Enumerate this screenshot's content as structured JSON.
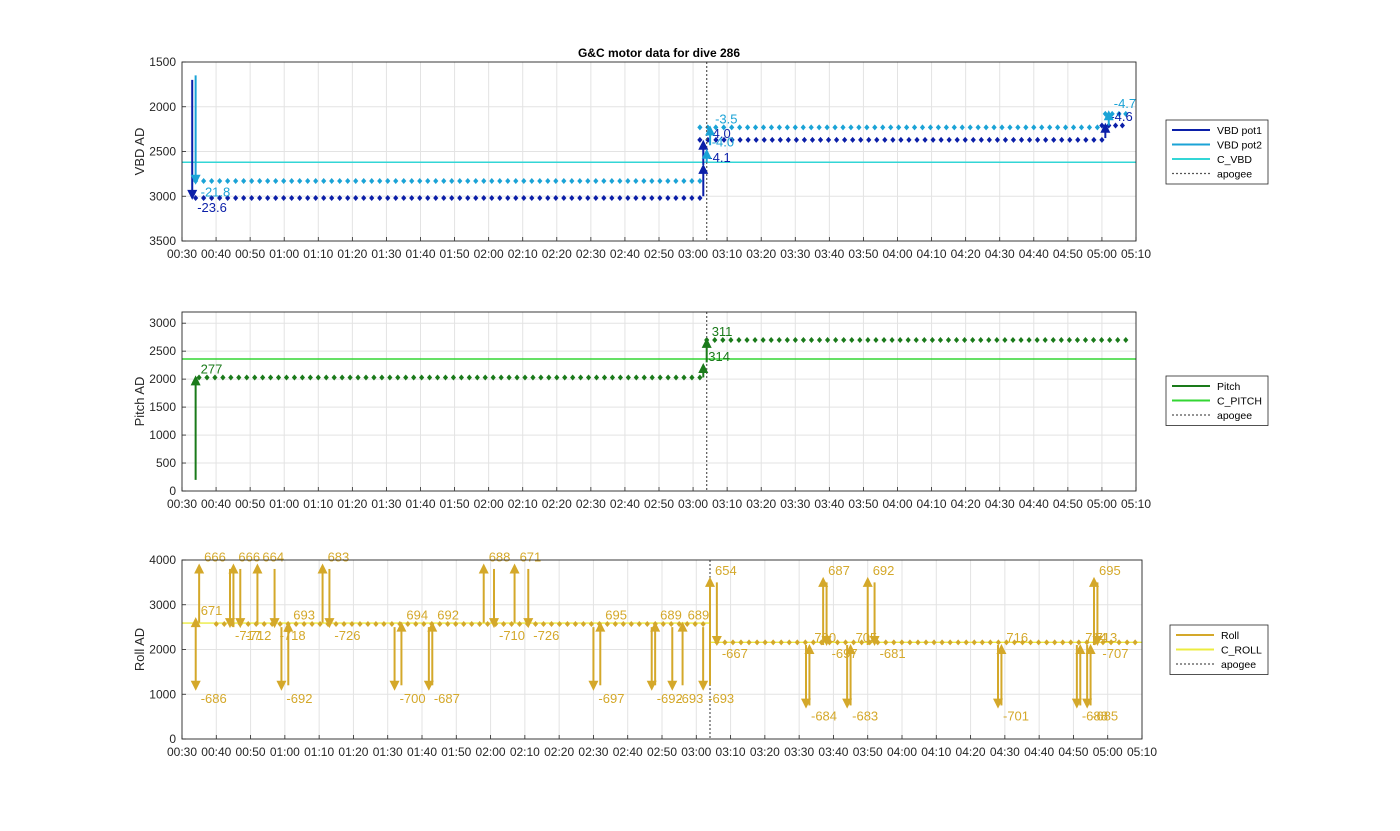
{
  "title": "G&C motor data for dive 286",
  "time_ticks": [
    "00:30",
    "00:40",
    "00:50",
    "01:00",
    "01:10",
    "01:20",
    "01:30",
    "01:40",
    "01:50",
    "02:00",
    "02:10",
    "02:20",
    "02:30",
    "02:40",
    "02:50",
    "03:00",
    "03:10",
    "03:20",
    "03:30",
    "03:40",
    "03:50",
    "04:00",
    "04:10",
    "04:20",
    "04:30",
    "04:40",
    "04:50",
    "05:00",
    "05:10"
  ],
  "chart_data": [
    {
      "type": "scatter",
      "ylabel": "VBD AD",
      "xlim": [
        "00:30",
        "05:10"
      ],
      "ylim": [
        3500,
        1500
      ],
      "y_reversed": true,
      "yticks": [
        1500,
        2000,
        2500,
        3000,
        3500
      ],
      "yticklabels": [
        "1500",
        "2000",
        "2500",
        "3000",
        "3500"
      ],
      "grid": true,
      "legend_position": "right",
      "apogee": "03:04",
      "legend": [
        {
          "label": "VBD pot1",
          "color": "#0b1fa8",
          "style": "solid"
        },
        {
          "label": "VBD pot2",
          "color": "#1ba3d6",
          "style": "solid"
        },
        {
          "label": "C_VBD",
          "color": "#33d6d6",
          "style": "solid"
        },
        {
          "label": "apogee",
          "color": "#555555",
          "style": "dotted"
        }
      ],
      "hlines": [
        {
          "label": "C_VBD",
          "value": 2620,
          "color": "#33d6d6"
        }
      ],
      "series": [
        {
          "name": "VBD pot1",
          "color": "#0b1fa8",
          "segments": [
            {
              "from": "00:34",
              "to": "03:02",
              "y": 3020
            },
            {
              "from": "03:02",
              "to": "05:00",
              "y": 2370
            },
            {
              "from": "05:00",
              "to": "05:06",
              "y": 2210
            }
          ]
        },
        {
          "name": "VBD pot2",
          "color": "#1ba3d6",
          "segments": [
            {
              "from": "00:34",
              "to": "03:02",
              "y": 2830
            },
            {
              "from": "03:02",
              "to": "05:01",
              "y": 2230
            },
            {
              "from": "05:01",
              "to": "05:07",
              "y": 2080
            }
          ]
        }
      ],
      "moves": [
        {
          "t": "00:33",
          "from": 1700,
          "to": 3030,
          "color": "#0b1fa8",
          "label": "-23.6"
        },
        {
          "t": "00:34",
          "from": 1650,
          "to": 2860,
          "color": "#1ba3d6",
          "label": "-21.8"
        },
        {
          "t": "03:03",
          "from": 3000,
          "to": 2650,
          "color": "#0b1fa8",
          "label": "-4.1"
        },
        {
          "t": "03:03",
          "from": 2650,
          "to": 2380,
          "color": "#0b1fa8",
          "label": "-4.0"
        },
        {
          "t": "03:04",
          "from": 2620,
          "to": 2480,
          "color": "#1ba3d6",
          "label": "-4.0"
        },
        {
          "t": "03:05",
          "from": 2430,
          "to": 2220,
          "color": "#1ba3d6",
          "label": "-3.5"
        },
        {
          "t": "05:01",
          "from": 2350,
          "to": 2190,
          "color": "#0b1fa8",
          "label": "-4.6"
        },
        {
          "t": "05:02",
          "from": 2210,
          "to": 2050,
          "color": "#1ba3d6",
          "label": "-4.7"
        }
      ]
    },
    {
      "type": "scatter",
      "ylabel": "Pitch AD",
      "xlim": [
        "00:30",
        "05:10"
      ],
      "ylim": [
        0,
        3200
      ],
      "yticks": [
        0,
        500,
        1000,
        1500,
        2000,
        2500,
        3000
      ],
      "yticklabels": [
        "0",
        "500",
        "1000",
        "1500",
        "2000",
        "2500",
        "3000"
      ],
      "grid": true,
      "legend_position": "right",
      "apogee": "03:04",
      "legend": [
        {
          "label": "Pitch",
          "color": "#1a7a1a",
          "style": "solid"
        },
        {
          "label": "C_PITCH",
          "color": "#33d633",
          "style": "solid"
        },
        {
          "label": "apogee",
          "color": "#555555",
          "style": "dotted"
        }
      ],
      "hlines": [
        {
          "label": "C_PITCH",
          "value": 2360,
          "color": "#33d633"
        }
      ],
      "series": [
        {
          "name": "Pitch",
          "color": "#1a7a1a",
          "segments": [
            {
              "from": "00:35",
              "to": "03:02",
              "y": 2030
            },
            {
              "from": "03:04",
              "to": "05:07",
              "y": 2700
            }
          ]
        }
      ],
      "moves": [
        {
          "t": "00:34",
          "from": 200,
          "to": 2050,
          "color": "#1a7a1a",
          "label": "277"
        },
        {
          "t": "03:03",
          "from": 2030,
          "to": 2270,
          "color": "#1a7a1a",
          "label": "314"
        },
        {
          "t": "03:04",
          "from": 2300,
          "to": 2720,
          "color": "#1a7a1a",
          "label": "311"
        }
      ]
    },
    {
      "type": "scatter",
      "ylabel": "Roll AD",
      "xlim": [
        "00:30",
        "05:10"
      ],
      "ylim": [
        0,
        4000
      ],
      "yticks": [
        0,
        1000,
        2000,
        3000,
        4000
      ],
      "yticklabels": [
        "0",
        "1000",
        "2000",
        "3000",
        "4000"
      ],
      "grid": true,
      "legend_position": "right",
      "apogee": "03:04",
      "legend": [
        {
          "label": "Roll",
          "color": "#d4a82a",
          "style": "solid"
        },
        {
          "label": "C_ROLL",
          "color": "#ecec40",
          "style": "solid"
        },
        {
          "label": "apogee",
          "color": "#555555",
          "style": "dotted"
        }
      ],
      "hlines": [
        {
          "label": "C_ROLL",
          "from": "00:30",
          "to": "03:04",
          "value": 2590,
          "color": "#ecec40"
        },
        {
          "label": "C_ROLL",
          "from": "03:04",
          "to": "05:10",
          "value": 2160,
          "color": "#ecec40"
        }
      ],
      "series": [
        {
          "name": "Roll",
          "color": "#d4a82a",
          "segments": [
            {
              "from": "00:40",
              "to": "03:02",
              "y": 2570
            },
            {
              "from": "03:06",
              "to": "05:08",
              "y": 2160
            }
          ]
        }
      ],
      "moves": [
        {
          "t": "00:34",
          "from": 2600,
          "to": 1100,
          "color": "#d4a82a",
          "label": "-686"
        },
        {
          "t": "00:34",
          "from": 2600,
          "to": 2700,
          "color": "#d4a82a",
          "label": "671"
        },
        {
          "t": "00:35",
          "from": 2600,
          "to": 3900,
          "color": "#d4a82a",
          "label": "666"
        },
        {
          "t": "00:44",
          "from": 3800,
          "to": 2500,
          "color": "#d4a82a",
          "label": "-717"
        },
        {
          "t": "00:45",
          "from": 2500,
          "to": 3900,
          "color": "#d4a82a",
          "label": "666"
        },
        {
          "t": "00:47",
          "from": 3800,
          "to": 2500,
          "color": "#d4a82a",
          "label": "-712"
        },
        {
          "t": "00:52",
          "from": 2550,
          "to": 3900,
          "color": "#d4a82a",
          "label": "664"
        },
        {
          "t": "00:57",
          "from": 3800,
          "to": 2500,
          "color": "#d4a82a",
          "label": "-718"
        },
        {
          "t": "00:59",
          "from": 2500,
          "to": 1100,
          "color": "#d4a82a",
          "label": "-692"
        },
        {
          "t": "01:01",
          "from": 1200,
          "to": 2600,
          "color": "#d4a82a",
          "label": "693"
        },
        {
          "t": "01:11",
          "from": 2600,
          "to": 3900,
          "color": "#d4a82a",
          "label": "683"
        },
        {
          "t": "01:13",
          "from": 3800,
          "to": 2500,
          "color": "#d4a82a",
          "label": "-726"
        },
        {
          "t": "01:32",
          "from": 2500,
          "to": 1100,
          "color": "#d4a82a",
          "label": "-700"
        },
        {
          "t": "01:34",
          "from": 1200,
          "to": 2600,
          "color": "#d4a82a",
          "label": "694"
        },
        {
          "t": "01:42",
          "from": 2500,
          "to": 1100,
          "color": "#d4a82a",
          "label": "-687"
        },
        {
          "t": "01:43",
          "from": 1200,
          "to": 2600,
          "color": "#d4a82a",
          "label": "692"
        },
        {
          "t": "01:58",
          "from": 2600,
          "to": 3900,
          "color": "#d4a82a",
          "label": "688"
        },
        {
          "t": "02:01",
          "from": 3800,
          "to": 2500,
          "color": "#d4a82a",
          "label": "-710"
        },
        {
          "t": "02:07",
          "from": 2600,
          "to": 3900,
          "color": "#d4a82a",
          "label": "671"
        },
        {
          "t": "02:11",
          "from": 3800,
          "to": 2500,
          "color": "#d4a82a",
          "label": "-726"
        },
        {
          "t": "02:30",
          "from": 2500,
          "to": 1100,
          "color": "#d4a82a",
          "label": "-697"
        },
        {
          "t": "02:32",
          "from": 1200,
          "to": 2600,
          "color": "#d4a82a",
          "label": "695"
        },
        {
          "t": "02:47",
          "from": 2500,
          "to": 1100,
          "color": "#d4a82a",
          "label": "-692"
        },
        {
          "t": "02:48",
          "from": 1200,
          "to": 2600,
          "color": "#d4a82a",
          "label": "689"
        },
        {
          "t": "02:53",
          "from": 2500,
          "to": 1100,
          "color": "#d4a82a",
          "label": "-693"
        },
        {
          "t": "02:56",
          "from": 1200,
          "to": 2600,
          "color": "#d4a82a",
          "label": "689"
        },
        {
          "t": "03:02",
          "from": 2500,
          "to": 1100,
          "color": "#d4a82a",
          "label": "-693"
        },
        {
          "t": "03:04",
          "from": 1200,
          "to": 3600,
          "color": "#d4a82a",
          "label": "654"
        },
        {
          "t": "03:06",
          "from": 3500,
          "to": 2100,
          "color": "#d4a82a",
          "label": "-667"
        },
        {
          "t": "03:32",
          "from": 2100,
          "to": 700,
          "color": "#d4a82a",
          "label": "-684"
        },
        {
          "t": "03:33",
          "from": 750,
          "to": 2100,
          "color": "#d4a82a",
          "label": "700"
        },
        {
          "t": "03:37",
          "from": 2100,
          "to": 3600,
          "color": "#d4a82a",
          "label": "687"
        },
        {
          "t": "03:38",
          "from": 3500,
          "to": 2100,
          "color": "#d4a82a",
          "label": "-697"
        },
        {
          "t": "03:44",
          "from": 2100,
          "to": 700,
          "color": "#d4a82a",
          "label": "-683"
        },
        {
          "t": "03:45",
          "from": 750,
          "to": 2100,
          "color": "#d4a82a",
          "label": "705"
        },
        {
          "t": "03:50",
          "from": 2100,
          "to": 3600,
          "color": "#d4a82a",
          "label": "692"
        },
        {
          "t": "03:52",
          "from": 3500,
          "to": 2100,
          "color": "#d4a82a",
          "label": "-681"
        },
        {
          "t": "04:28",
          "from": 2100,
          "to": 700,
          "color": "#d4a82a",
          "label": "-701"
        },
        {
          "t": "04:29",
          "from": 750,
          "to": 2100,
          "color": "#d4a82a",
          "label": "716"
        },
        {
          "t": "04:51",
          "from": 2100,
          "to": 700,
          "color": "#d4a82a",
          "label": "-688"
        },
        {
          "t": "04:52",
          "from": 750,
          "to": 2100,
          "color": "#d4a82a",
          "label": "714"
        },
        {
          "t": "04:54",
          "from": 2100,
          "to": 700,
          "color": "#d4a82a",
          "label": "-685"
        },
        {
          "t": "04:55",
          "from": 750,
          "to": 2100,
          "color": "#d4a82a",
          "label": "713"
        },
        {
          "t": "04:56",
          "from": 2100,
          "to": 3600,
          "color": "#d4a82a",
          "label": "695"
        },
        {
          "t": "04:57",
          "from": 3500,
          "to": 2100,
          "color": "#d4a82a",
          "label": "-707"
        }
      ]
    }
  ]
}
